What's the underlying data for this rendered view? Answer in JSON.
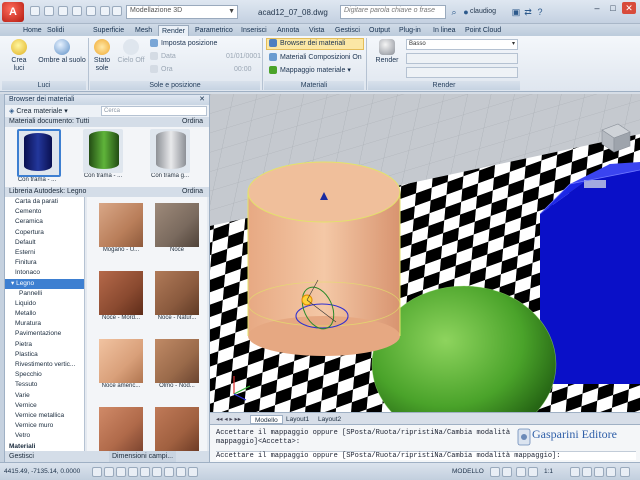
{
  "titlebar": {
    "app_button": "A",
    "workspace": "Modellazione 3D",
    "document": "acad12_07_08.dwg",
    "search_placeholder": "Digitare parola chiave o frase",
    "user": "claudiog",
    "min": "–",
    "max": "□",
    "close": "✕"
  },
  "tabs": [
    "Home",
    "Solidi",
    "Superficie",
    "Mesh",
    "Render",
    "Parametrico",
    "Inserisci",
    "Annota",
    "Vista",
    "Gestisci",
    "Output",
    "Plug-in",
    "In linea",
    "Point Cloud"
  ],
  "active_tab": "Render",
  "ribbon": {
    "luci": {
      "title": "Luci",
      "crea_luci": "Crea luci",
      "ombre": "Ombre al suolo"
    },
    "sole": {
      "title": "Sole e posizione",
      "stato_sole": "Stato sole",
      "cielo_off": "Cielo Off",
      "imposta_posizione": "Imposta posizione",
      "data_label": "Data",
      "data_value": "01/01/0001",
      "ora_label": "Ora",
      "ora_value": "00:00"
    },
    "materiali": {
      "title": "Materiali",
      "browser": "Browser dei materiali",
      "composizioni": "Materiali Composizioni On",
      "mappaggio": "Mappaggio materiale"
    },
    "render": {
      "title": "Render",
      "render_btn": "Render",
      "quality": "Basso"
    }
  },
  "palette": {
    "title": "Browser dei materiali",
    "create_material": "Crea materiale",
    "search_placeholder": "Cerca",
    "doc_materials_label": "Materiali documento: Tutti",
    "sort_label": "Ordina",
    "doc_materials": [
      {
        "label": "Con trama - ...",
        "color": "#1c2b8a"
      },
      {
        "label": "Con trama - ...",
        "color": "#3f8a2a"
      },
      {
        "label": "Con trama g...",
        "color": "#b9bcc0"
      }
    ],
    "library_label": "Libreria Autodesk: Legno",
    "library_sort": "Ordina",
    "tree": [
      "Carta da parati",
      "Cemento",
      "Ceramica",
      "Copertura",
      "Default",
      "Esterni",
      "Finitura",
      "Intonaco",
      "Legno",
      "Pannelli",
      "Liquido",
      "Metallo",
      "Muratura",
      "Pavimentazione",
      "Pietra",
      "Plastica",
      "Rivestimento vertic...",
      "Specchio",
      "Tessuto",
      "Varie",
      "Vernice",
      "Vernice metallica",
      "Vernice muro",
      "Vetro",
      "Materiali"
    ],
    "selected_tree": "Legno",
    "library_materials": [
      {
        "label": "Mogano - U...",
        "color": "#b97e5a"
      },
      {
        "label": "Noce",
        "color": "#7a6a5e"
      },
      {
        "label": "Noce - Mord...",
        "color": "#8a4a30"
      },
      {
        "label": "Noce - Natur...",
        "color": "#8a5a3e"
      },
      {
        "label": "Noce americ...",
        "color": "#d9a07a"
      },
      {
        "label": "Olmo - Nod...",
        "color": "#9a6a4a"
      },
      {
        "label": "",
        "color": "#b06a4a"
      },
      {
        "label": "",
        "color": "#a06040"
      }
    ],
    "bottom_left": "Gestisci",
    "bottom_right": "Dimensioni campi..."
  },
  "layout_tabs": [
    "Modello",
    "Layout1",
    "Layout2"
  ],
  "command": {
    "line1a": "Accettare il mappaggio oppure [SPosta/Ruota/ripristiNa/Cambia modalità",
    "line1b": "mappaggio]<Accetta>:",
    "line2": "Accettare il mappaggio oppure [SPosta/Ruota/ripristiNa/Cambia modalità mappaggio]:",
    "watermark": "Gasparini Editore"
  },
  "status": {
    "coords": "4415.49, -7135.14, 0.0000",
    "model": "MODELLO",
    "scale": "1:1"
  },
  "colors": {
    "accent": "#3d7fd1",
    "blue_box": "#0a10c8",
    "sphere": "#4aa32a",
    "cylinder": "#e9b08a"
  }
}
